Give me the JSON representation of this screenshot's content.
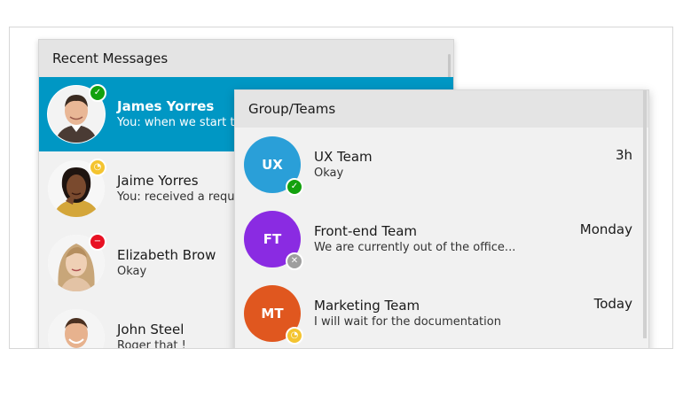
{
  "recent": {
    "title": "Recent Messages",
    "items": [
      {
        "name": "James Yorres",
        "message": "You: when we start the",
        "status": "available",
        "selected": true
      },
      {
        "name": "Jaime Yorres",
        "message": "You: received a reque",
        "status": "away",
        "selected": false
      },
      {
        "name": "Elizabeth Brow",
        "message": "Okay",
        "status": "busy",
        "selected": false
      },
      {
        "name": "John Steel",
        "message": "Roger that !",
        "status": "none",
        "selected": false
      }
    ]
  },
  "groups": {
    "title": "Group/Teams",
    "items": [
      {
        "initials": "UX",
        "name": "UX Team",
        "message": "Okay",
        "time": "3h",
        "color": "#2a9fd8",
        "status": "available"
      },
      {
        "initials": "FT",
        "name": "Front-end Team",
        "message": "We are currently out of the office...",
        "time": "Monday",
        "color": "#8a2be2",
        "status": "offline"
      },
      {
        "initials": "MT",
        "name": "Marketing Team",
        "message": "I will wait for the documentation",
        "time": "Today",
        "color": "#e0571f",
        "status": "away"
      }
    ]
  },
  "colors": {
    "selected_row": "#0097c4",
    "available": "#13a10e",
    "away": "#f4c430",
    "busy": "#e81123",
    "offline": "#9e9e9e"
  },
  "icons": {
    "available": "check-icon",
    "away": "clock-icon",
    "busy": "minus-icon",
    "offline": "x-icon"
  }
}
